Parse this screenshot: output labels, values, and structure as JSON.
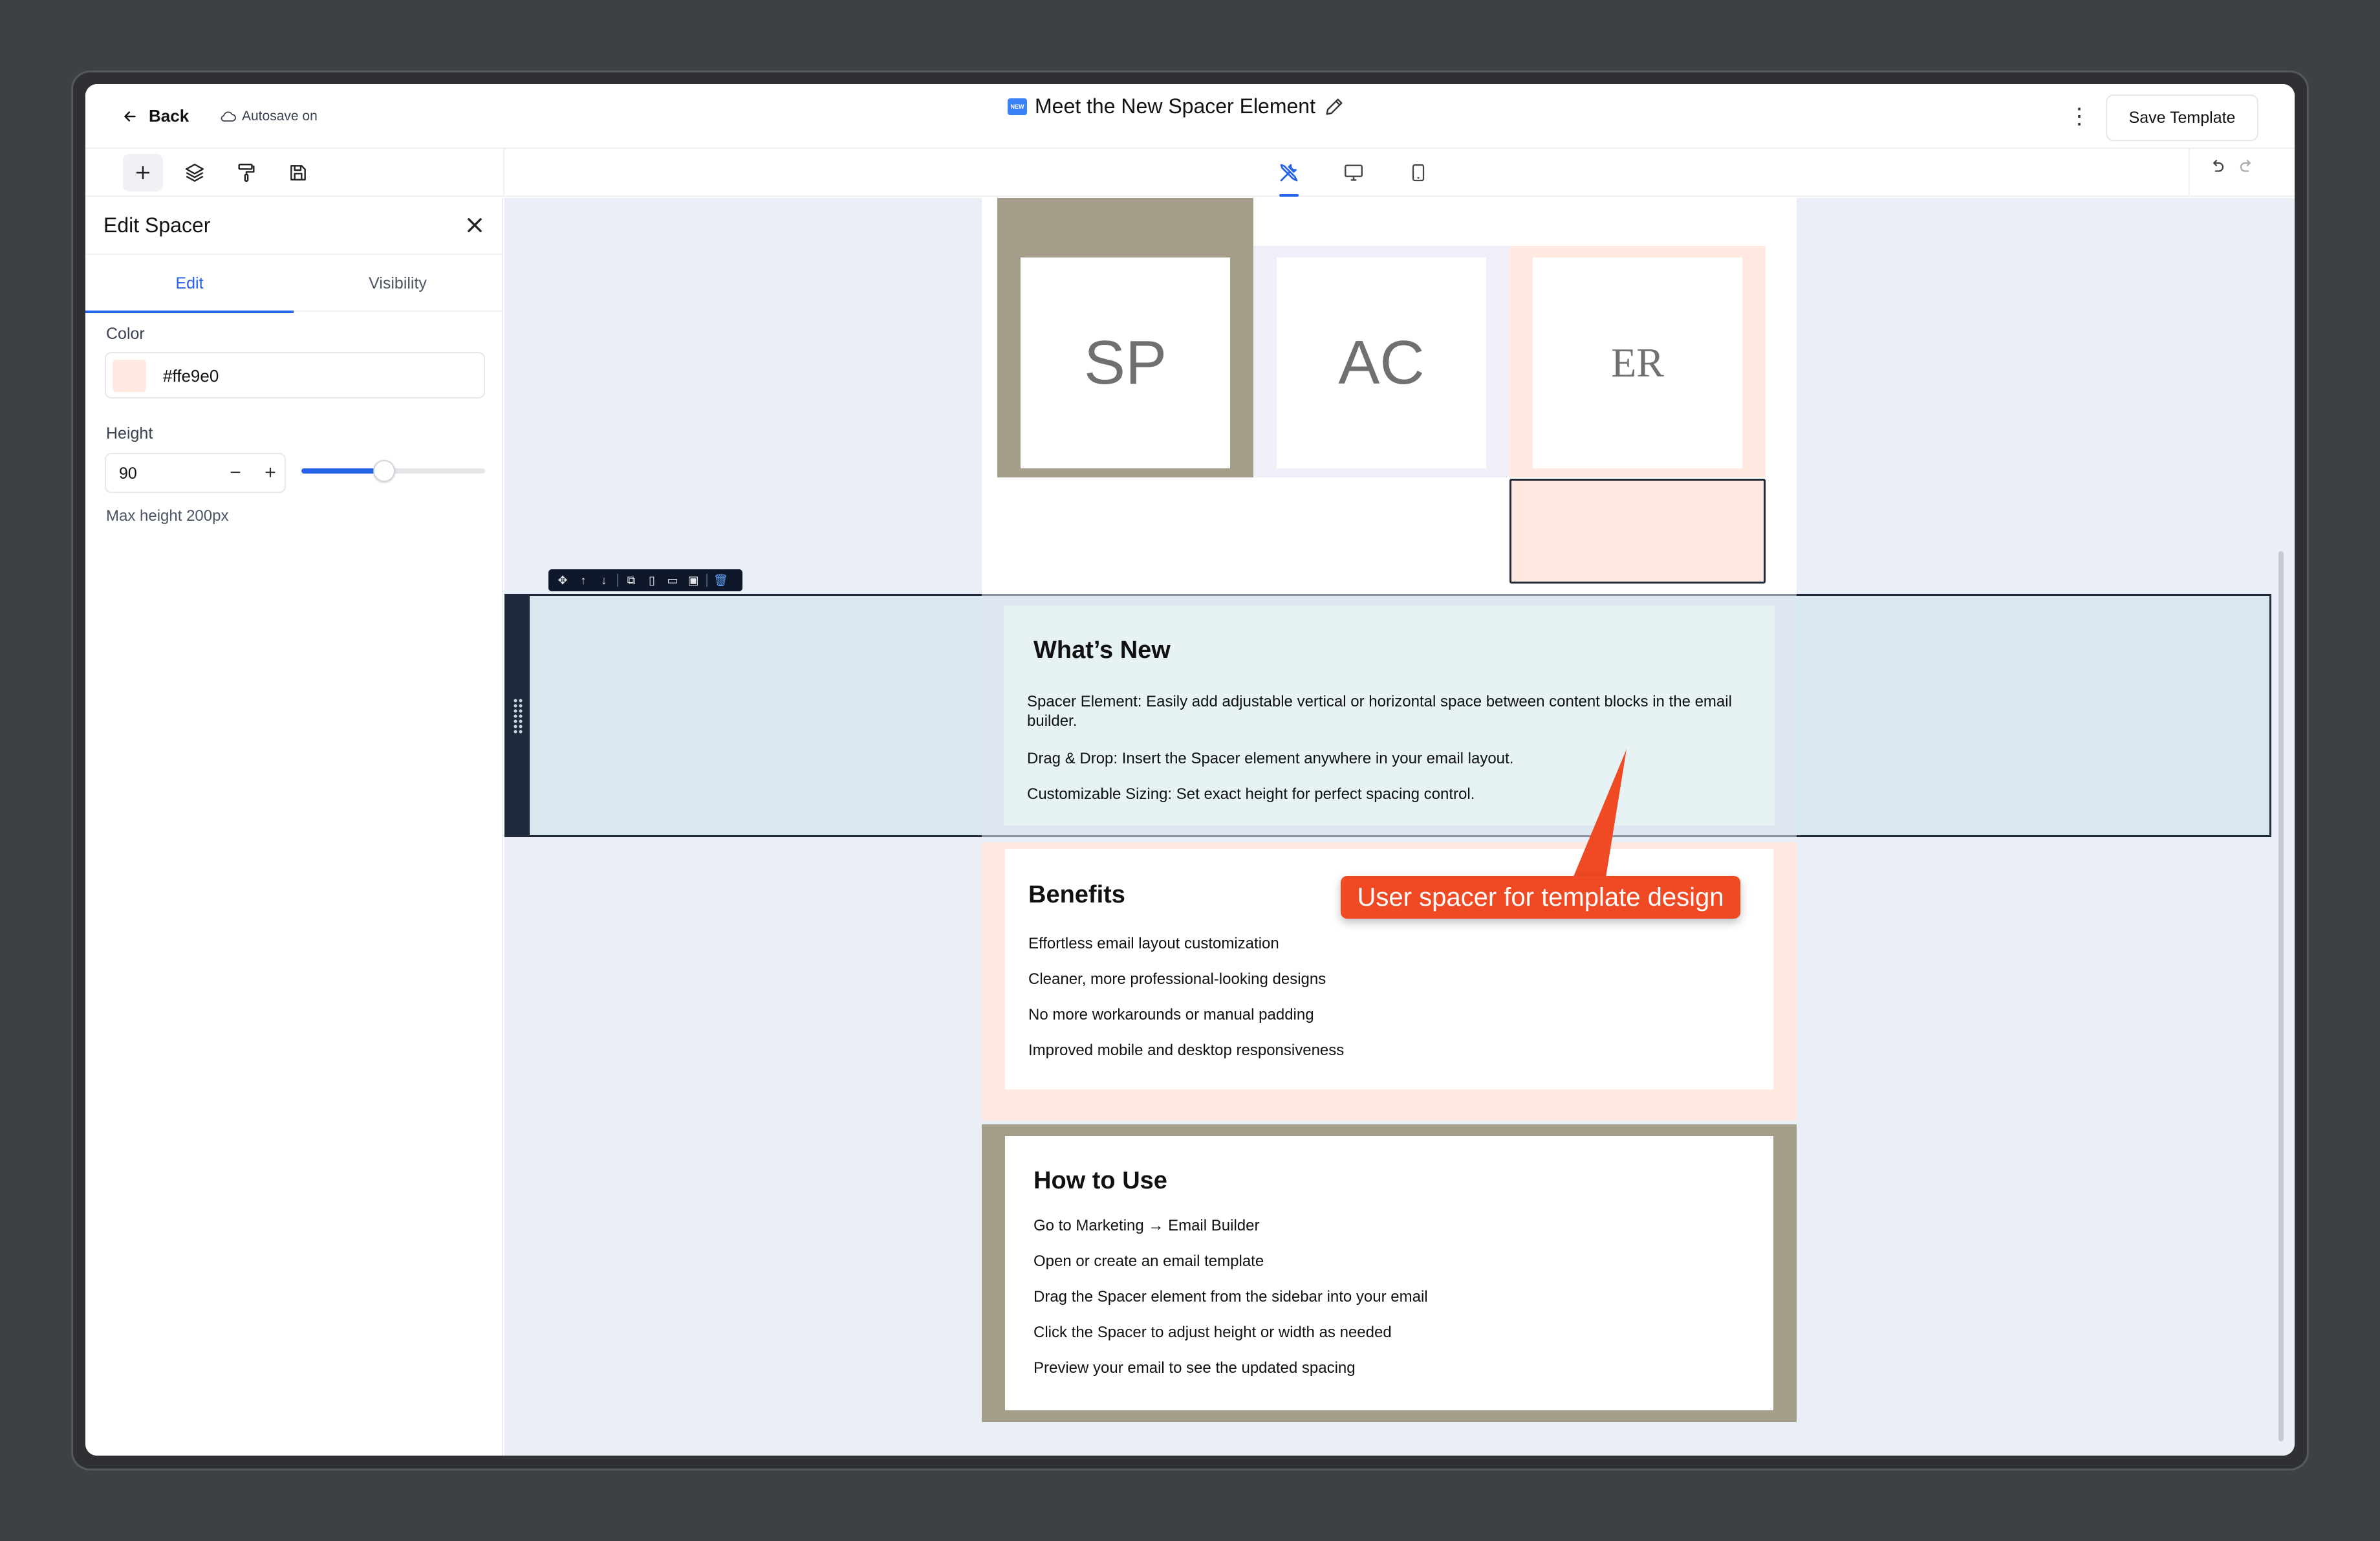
{
  "header": {
    "back_label": "Back",
    "autosave_label": "Autosave on",
    "title_badge": "NEW",
    "title": "Meet the New Spacer Element",
    "save_label": "Save Template"
  },
  "panel": {
    "title": "Edit Spacer",
    "tabs": [
      "Edit",
      "Visibility"
    ],
    "color_label": "Color",
    "color_value": "#ffe9e0",
    "height_label": "Height",
    "height_value": "90",
    "height_minus": "−",
    "height_plus": "+",
    "height_fraction": 0.45,
    "max_hint": "Max height 200px"
  },
  "canvas": {
    "tiles": [
      {
        "text": "SP",
        "bg": "#a39d8a"
      },
      {
        "text": "AC",
        "bg": "#efeef9"
      },
      {
        "text": "ER",
        "bg": "#ffe9e0"
      }
    ],
    "whats_new": {
      "title": "What’s New",
      "items": [
        "Spacer Element: Easily add adjustable vertical or horizontal space between content blocks in the email builder.",
        "Drag & Drop: Insert the Spacer element anywhere in your email layout.",
        "Customizable Sizing: Set exact height for perfect spacing control."
      ]
    },
    "benefits": {
      "title": "Benefits",
      "items": [
        "Effortless email layout customization",
        "Cleaner, more professional-looking designs",
        "No more workarounds or manual padding",
        "Improved mobile and desktop responsiveness"
      ]
    },
    "how_to": {
      "title": "How to Use",
      "items": [
        "Go to Marketing → Email Builder",
        "Open or create an email template",
        "Drag the Spacer element from the sidebar into your email",
        "Click the Spacer to adjust height or width as needed",
        "Preview your email to see the updated spacing"
      ]
    }
  },
  "annotation": {
    "callout": "User spacer for template design",
    "color": "#ef4a23"
  },
  "colors": {
    "accent": "#2563eb",
    "spacer": "#ffe9e0",
    "taupe": "#a39d8a"
  }
}
